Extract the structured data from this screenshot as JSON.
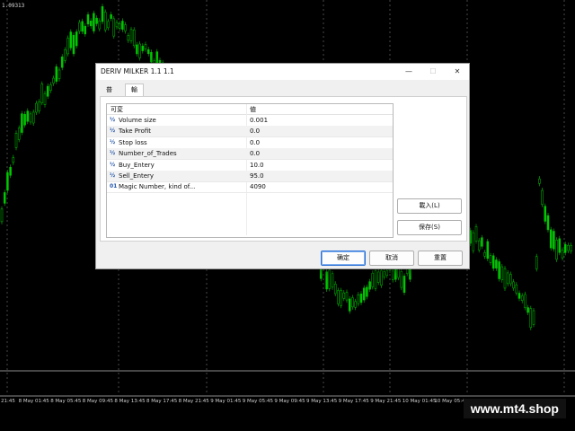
{
  "chart": {
    "price_label": "1.09313",
    "time_labels": [
      "21:45",
      "8 May 01:45",
      "8 May 05:45",
      "8 May 09:45",
      "8 May 13:45",
      "8 May 17:45",
      "8 May 21:45",
      "9 May 01:45",
      "9 May 05:45",
      "9 May 09:45",
      "9 May 13:45",
      "9 May 17:45",
      "9 May 21:45",
      "10 May 01:45",
      "10 May 05:45",
      "10 May 09:45",
      "10 May 13:45",
      "10 May 17:45"
    ],
    "candle_color": "#00c800",
    "grid_color": "#7a7a7a"
  },
  "dialog": {
    "title": "DERIV MILKER 1.1 1.1",
    "window_buttons": {
      "minimize": "—",
      "maximize": "☐",
      "close": "✕"
    },
    "tabs": [
      "普通",
      "輸入"
    ],
    "active_tab": 1,
    "table": {
      "header_variable": "可変",
      "header_value": "値",
      "rows": [
        {
          "icon": "½",
          "name": "Volume size",
          "value": "0.001"
        },
        {
          "icon": "½",
          "name": "Take Profit",
          "value": "0.0"
        },
        {
          "icon": "½",
          "name": "Stop loss",
          "value": "0.0"
        },
        {
          "icon": "½",
          "name": "Number_of_Trades",
          "value": "0.0"
        },
        {
          "icon": "½",
          "name": "Buy_Entery",
          "value": "10.0"
        },
        {
          "icon": "½",
          "name": "Sell_Entery",
          "value": "95.0"
        },
        {
          "icon": "01",
          "name": "Magic Number, kind of...",
          "value": "4090"
        }
      ]
    },
    "buttons": {
      "load": "載入(L)",
      "save": "保存(S)",
      "ok": "确定",
      "cancel": "取消",
      "reset": "重置"
    }
  },
  "watermark": "www.mt4.shop"
}
